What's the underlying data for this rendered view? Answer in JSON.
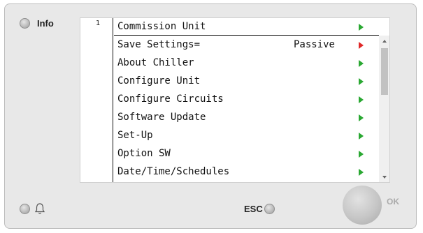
{
  "info_label": "Info",
  "esc_label": "ESC",
  "ok_label": "OK",
  "page_number": "1",
  "colors": {
    "arrow_green": "#2aa832",
    "arrow_red": "#e02828"
  },
  "menu": {
    "header": "Commission Unit",
    "items": [
      {
        "label": "Save Settings=",
        "value": "Passive",
        "arrow": "red"
      },
      {
        "label": "About Chiller",
        "value": "",
        "arrow": "green"
      },
      {
        "label": "Configure Unit",
        "value": "",
        "arrow": "green"
      },
      {
        "label": "Configure Circuits",
        "value": "",
        "arrow": "green"
      },
      {
        "label": "Software Update",
        "value": "",
        "arrow": "green"
      },
      {
        "label": "Set-Up",
        "value": "",
        "arrow": "green"
      },
      {
        "label": "Option SW",
        "value": "",
        "arrow": "green"
      },
      {
        "label": "Date/Time/Schedules",
        "value": "",
        "arrow": "green"
      }
    ]
  },
  "icons": {
    "alarm": "bell-icon"
  }
}
